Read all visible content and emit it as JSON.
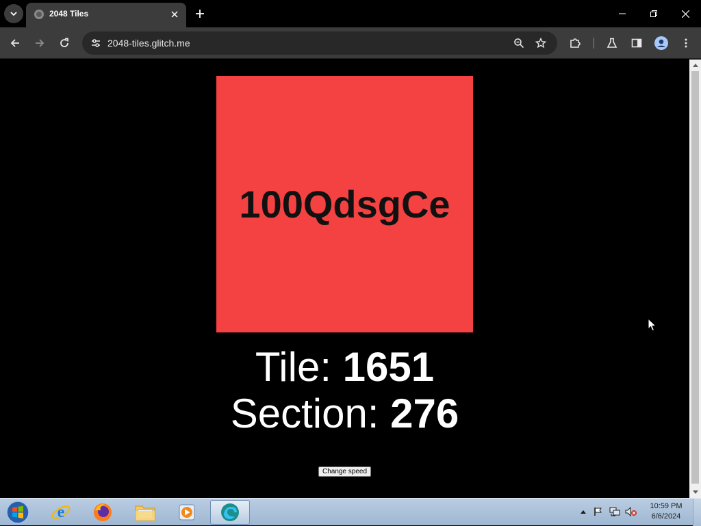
{
  "browser": {
    "tab_title": "2048 Tiles",
    "url": "2048-tiles.glitch.me"
  },
  "page": {
    "tile_text": "100QdsgCe",
    "tile_color": "#f44141",
    "tile_label": "Tile:",
    "tile_value": "1651",
    "section_label": "Section:",
    "section_value": "276",
    "change_speed_label": "Change speed"
  },
  "taskbar": {
    "time": "10:59 PM",
    "date": "6/6/2024",
    "apps": [
      "internet-explorer",
      "firefox",
      "file-explorer",
      "media-player",
      "edge"
    ]
  }
}
